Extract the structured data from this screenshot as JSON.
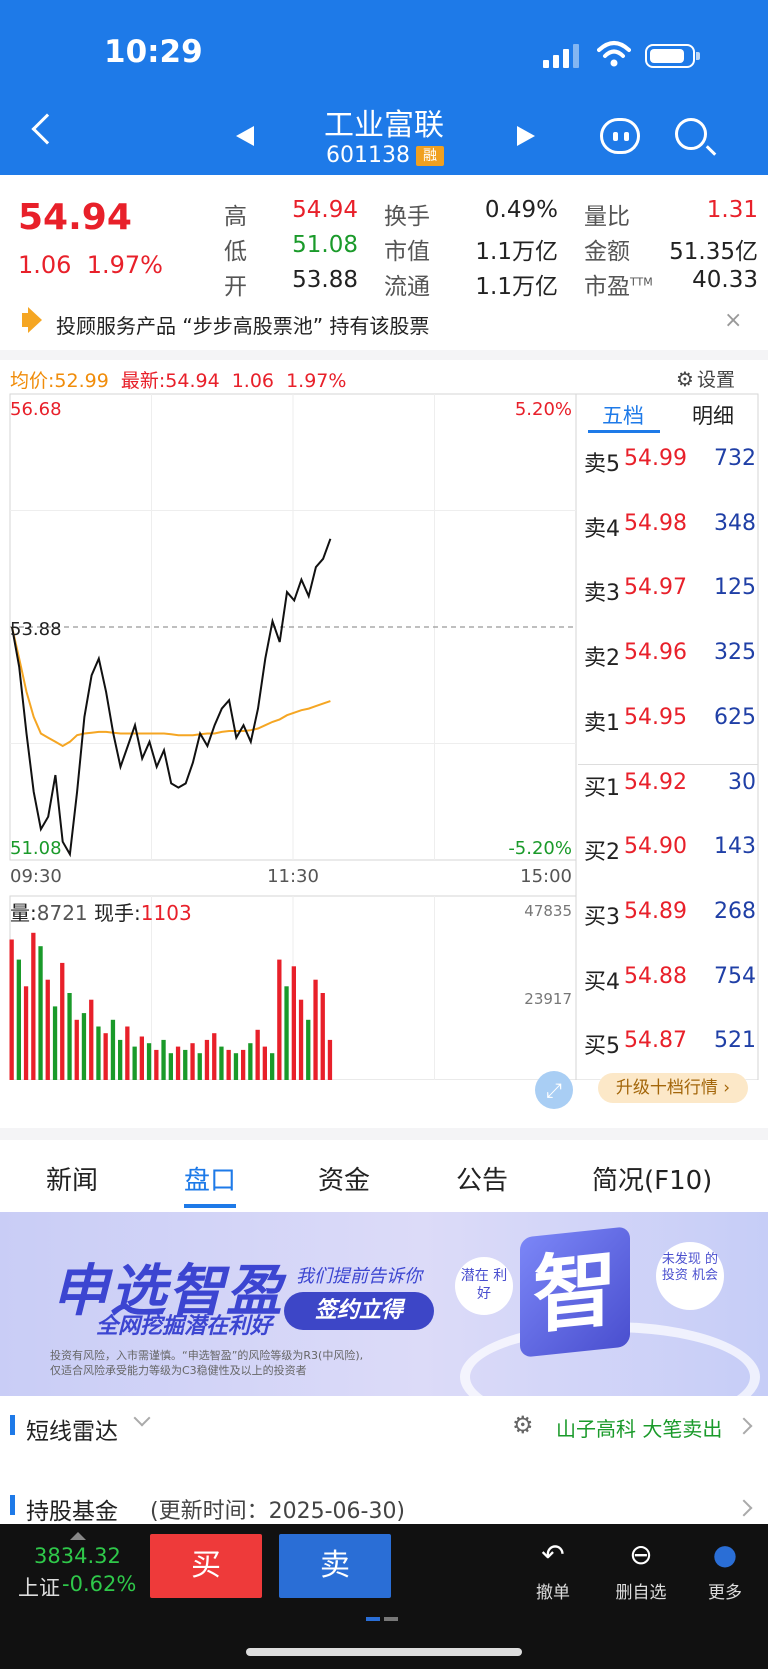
{
  "status_bar": {
    "time": "10:29"
  },
  "header": {
    "stock_name": "工业富联",
    "stock_code": "601138",
    "margin_badge": "融"
  },
  "quote": {
    "price": "54.94",
    "change": "1.06",
    "change_pct": "1.97%",
    "stats": [
      {
        "label": "高",
        "value": "54.94",
        "color": "#e8202a"
      },
      {
        "label": "换手",
        "value": "0.49%",
        "color": "#222222"
      },
      {
        "label": "量比",
        "value": "1.31",
        "color": "#e8202a"
      },
      {
        "label": "低",
        "value": "51.08",
        "color": "#1a9a2a"
      },
      {
        "label": "市值",
        "value": "1.1万亿",
        "color": "#222222"
      },
      {
        "label": "金额",
        "value": "51.35亿",
        "color": "#222222"
      },
      {
        "label": "开",
        "value": "53.88",
        "color": "#222222"
      },
      {
        "label": "流通",
        "value": "1.1万亿",
        "color": "#222222"
      },
      {
        "label": "市盈",
        "label_sup": "TTM",
        "value": "40.33",
        "color": "#222222"
      }
    ]
  },
  "notice": {
    "text": "投顾服务产品 “步步高股票池” 持有该股票",
    "close": "×"
  },
  "chart_header": {
    "avg_label": "均价:",
    "avg_value": "52.99",
    "latest_label": "最新:",
    "latest_value": "54.94",
    "latest_change": "1.06",
    "latest_pct": "1.97%",
    "settings": "设置"
  },
  "chart_data": {
    "type": "line",
    "title": "",
    "y_left_top": "56.68",
    "y_left_mid": "53.88",
    "y_left_bottom": "51.08",
    "y_right_top": "5.20%",
    "y_right_bottom": "-5.20%",
    "x_ticks": [
      "09:30",
      "11:30",
      "15:00"
    ],
    "ylim": [
      51.08,
      56.68
    ],
    "reference_line": 53.88,
    "total_minutes": 240,
    "price_series": [
      53.88,
      53.4,
      52.6,
      51.9,
      51.45,
      51.6,
      52.1,
      51.3,
      51.15,
      51.9,
      52.8,
      53.3,
      53.5,
      53.1,
      52.6,
      52.2,
      52.45,
      52.7,
      52.3,
      52.5,
      52.2,
      52.4,
      52.0,
      51.95,
      52.0,
      52.25,
      52.6,
      52.45,
      52.7,
      52.9,
      53.0,
      52.55,
      52.7,
      52.5,
      52.9,
      53.5,
      53.95,
      53.7,
      54.3,
      54.2,
      54.45,
      54.25,
      54.6,
      54.7,
      54.94
    ],
    "avg_series": [
      53.88,
      53.5,
      53.1,
      52.8,
      52.6,
      52.55,
      52.5,
      52.45,
      52.5,
      52.58,
      52.6,
      52.61,
      52.62,
      52.62,
      52.61,
      52.6,
      52.6,
      52.6,
      52.6,
      52.6,
      52.6,
      52.6,
      52.59,
      52.58,
      52.58,
      52.58,
      52.59,
      52.6,
      52.6,
      52.62,
      52.63,
      52.63,
      52.63,
      52.64,
      52.66,
      52.7,
      52.74,
      52.77,
      52.82,
      52.85,
      52.88,
      52.9,
      52.93,
      52.96,
      52.99
    ],
    "volume_label": "量:",
    "volume_value": "8721",
    "current_hand_label": "现手:",
    "current_hand_value": "1103",
    "volume_ticks": [
      "47835",
      "23917"
    ],
    "volume_max": 47835,
    "volume_series": [
      42000,
      36000,
      28000,
      44000,
      40000,
      30000,
      22000,
      35000,
      26000,
      18000,
      20000,
      24000,
      16000,
      14000,
      18000,
      12000,
      16000,
      10000,
      13000,
      11000,
      9000,
      12000,
      8000,
      10000,
      9000,
      11000,
      8000,
      12000,
      14000,
      10000,
      9000,
      8000,
      9000,
      11000,
      15000,
      10000,
      8000,
      36000,
      28000,
      34000,
      24000,
      18000,
      30000,
      26000,
      12000
    ],
    "volume_colors": [
      "#e8202a",
      "#1a9a2a",
      "#e8202a",
      "#e8202a",
      "#1a9a2a",
      "#e8202a",
      "#1a9a2a",
      "#e8202a",
      "#1a9a2a",
      "#e8202a",
      "#1a9a2a",
      "#e8202a",
      "#1a9a2a",
      "#e8202a",
      "#1a9a2a",
      "#1a9a2a",
      "#e8202a",
      "#1a9a2a",
      "#e8202a",
      "#1a9a2a",
      "#e8202a",
      "#1a9a2a",
      "#1a9a2a",
      "#e8202a",
      "#1a9a2a",
      "#e8202a",
      "#1a9a2a",
      "#e8202a",
      "#e8202a",
      "#1a9a2a",
      "#e8202a",
      "#1a9a2a",
      "#e8202a",
      "#1a9a2a",
      "#e8202a",
      "#e8202a",
      "#1a9a2a",
      "#e8202a",
      "#1a9a2a",
      "#e8202a",
      "#e8202a",
      "#1a9a2a",
      "#e8202a",
      "#e8202a",
      "#e8202a"
    ]
  },
  "order_book": {
    "tabs": [
      "五档",
      "明细"
    ],
    "asks": [
      {
        "label": "卖5",
        "price": "54.99",
        "vol": "732"
      },
      {
        "label": "卖4",
        "price": "54.98",
        "vol": "348"
      },
      {
        "label": "卖3",
        "price": "54.97",
        "vol": "125"
      },
      {
        "label": "卖2",
        "price": "54.96",
        "vol": "325"
      },
      {
        "label": "卖1",
        "price": "54.95",
        "vol": "625"
      }
    ],
    "bids": [
      {
        "label": "买1",
        "price": "54.92",
        "vol": "30"
      },
      {
        "label": "买2",
        "price": "54.90",
        "vol": "143"
      },
      {
        "label": "买3",
        "price": "54.89",
        "vol": "268"
      },
      {
        "label": "买4",
        "price": "54.88",
        "vol": "754"
      },
      {
        "label": "买5",
        "price": "54.87",
        "vol": "521"
      }
    ],
    "upgrade": "升级十档行情 ›"
  },
  "tabs": [
    "新闻",
    "盘口",
    "资金",
    "公告",
    "简况(F10)"
  ],
  "banner": {
    "title": "申选智盈",
    "subtitle": "全网挖掘潜在利好",
    "tagline": "我们提前告诉你",
    "button": "签约立得",
    "disclaimer_1": "投资有风险，入市需谨慎。“申选智盈”的风险等级为R3(中风险),",
    "disclaimer_2": "仅适合风险承受能力等级为C3稳健性及以上的投资者",
    "circle_1": "潜在 利好",
    "big_char": "智",
    "circle_2": "未发现 的投资 机会"
  },
  "radar": {
    "title": "短线雷达",
    "alert": "山子高科 大笔卖出"
  },
  "fund": {
    "title": "持股基金",
    "updated": "(更新时间：2025-06-30)"
  },
  "bottom_bar": {
    "index_value": "3834.32",
    "index_name": "上证",
    "index_change": "-0.62%",
    "buy": "买",
    "sell": "卖",
    "actions": [
      {
        "icon": "undo-icon",
        "label": "撤单"
      },
      {
        "icon": "remove-watchlist-icon",
        "label": "删自选"
      },
      {
        "icon": "more-icon",
        "label": "更多"
      }
    ]
  }
}
